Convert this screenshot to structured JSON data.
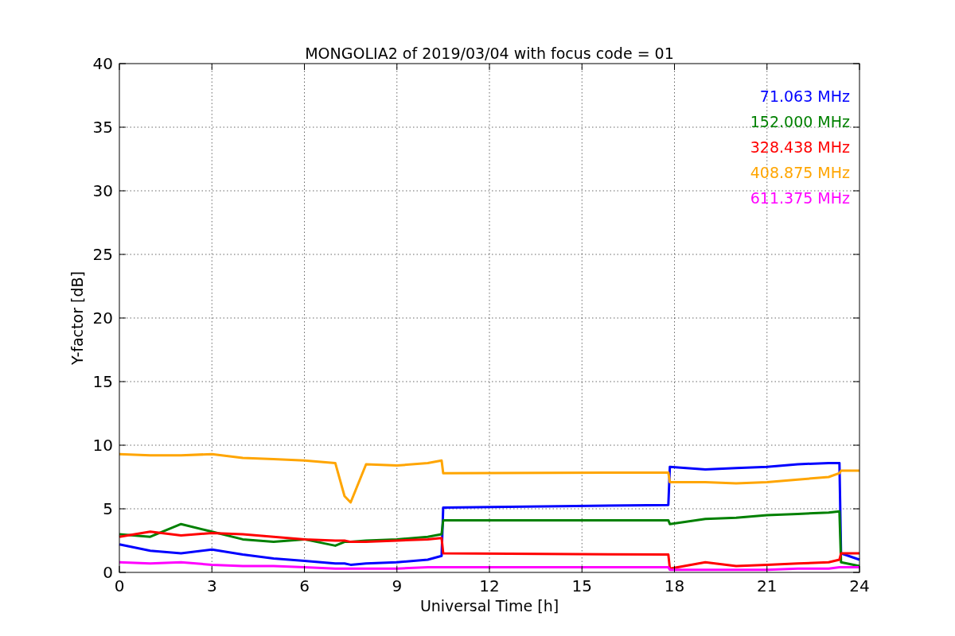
{
  "chart_data": {
    "type": "line",
    "title": "MONGOLIA2 of 2019/03/04 with focus code = 01",
    "xlabel": "Universal Time [h]",
    "ylabel": "Y-factor [dB]",
    "x": [
      0,
      1,
      2,
      3,
      4,
      5,
      6,
      7,
      7.3,
      7.5,
      8,
      9,
      10,
      10.45,
      10.5,
      17.8,
      17.85,
      19,
      20,
      21,
      22,
      23,
      23.35,
      23.4,
      24
    ],
    "series": [
      {
        "name": "71.063 MHz",
        "color": "#0000ff",
        "values": [
          2.2,
          1.7,
          1.5,
          1.8,
          1.4,
          1.1,
          0.9,
          0.7,
          0.7,
          0.6,
          0.7,
          0.8,
          1.0,
          1.3,
          5.1,
          5.3,
          8.3,
          8.1,
          8.2,
          8.3,
          8.5,
          8.6,
          8.6,
          1.5,
          1.0
        ]
      },
      {
        "name": "152.000 MHz",
        "color": "#008000",
        "values": [
          3.0,
          2.8,
          3.8,
          3.2,
          2.6,
          2.4,
          2.6,
          2.1,
          2.4,
          2.4,
          2.5,
          2.6,
          2.8,
          3.0,
          4.1,
          4.1,
          3.8,
          4.2,
          4.3,
          4.5,
          4.6,
          4.7,
          4.8,
          0.8,
          0.5
        ]
      },
      {
        "name": "328.438 MHz",
        "color": "#ff0000",
        "values": [
          2.8,
          3.2,
          2.9,
          3.1,
          3.0,
          2.8,
          2.6,
          2.5,
          2.5,
          2.4,
          2.4,
          2.5,
          2.6,
          2.7,
          1.5,
          1.4,
          0.3,
          0.8,
          0.5,
          0.6,
          0.7,
          0.8,
          1.0,
          1.5,
          1.5
        ]
      },
      {
        "name": "408.875 MHz",
        "color": "#ffa500",
        "values": [
          9.3,
          9.2,
          9.2,
          9.3,
          9.0,
          8.9,
          8.8,
          8.6,
          6.0,
          5.5,
          8.5,
          8.4,
          8.6,
          8.8,
          7.8,
          7.85,
          7.1,
          7.1,
          7.0,
          7.1,
          7.3,
          7.5,
          7.8,
          8.0,
          8.0
        ]
      },
      {
        "name": "611.375 MHz",
        "color": "#ff00ff",
        "values": [
          0.8,
          0.7,
          0.8,
          0.6,
          0.5,
          0.5,
          0.4,
          0.3,
          0.3,
          0.3,
          0.3,
          0.3,
          0.4,
          0.4,
          0.4,
          0.4,
          0.2,
          0.2,
          0.2,
          0.2,
          0.3,
          0.3,
          0.4,
          0.4,
          0.4
        ]
      }
    ],
    "xlim": [
      0,
      24
    ],
    "ylim": [
      0,
      40
    ],
    "xticks": [
      0,
      3,
      6,
      9,
      12,
      15,
      18,
      21,
      24
    ],
    "yticks": [
      0,
      5,
      10,
      15,
      20,
      25,
      30,
      35,
      40
    ],
    "grid": true
  }
}
